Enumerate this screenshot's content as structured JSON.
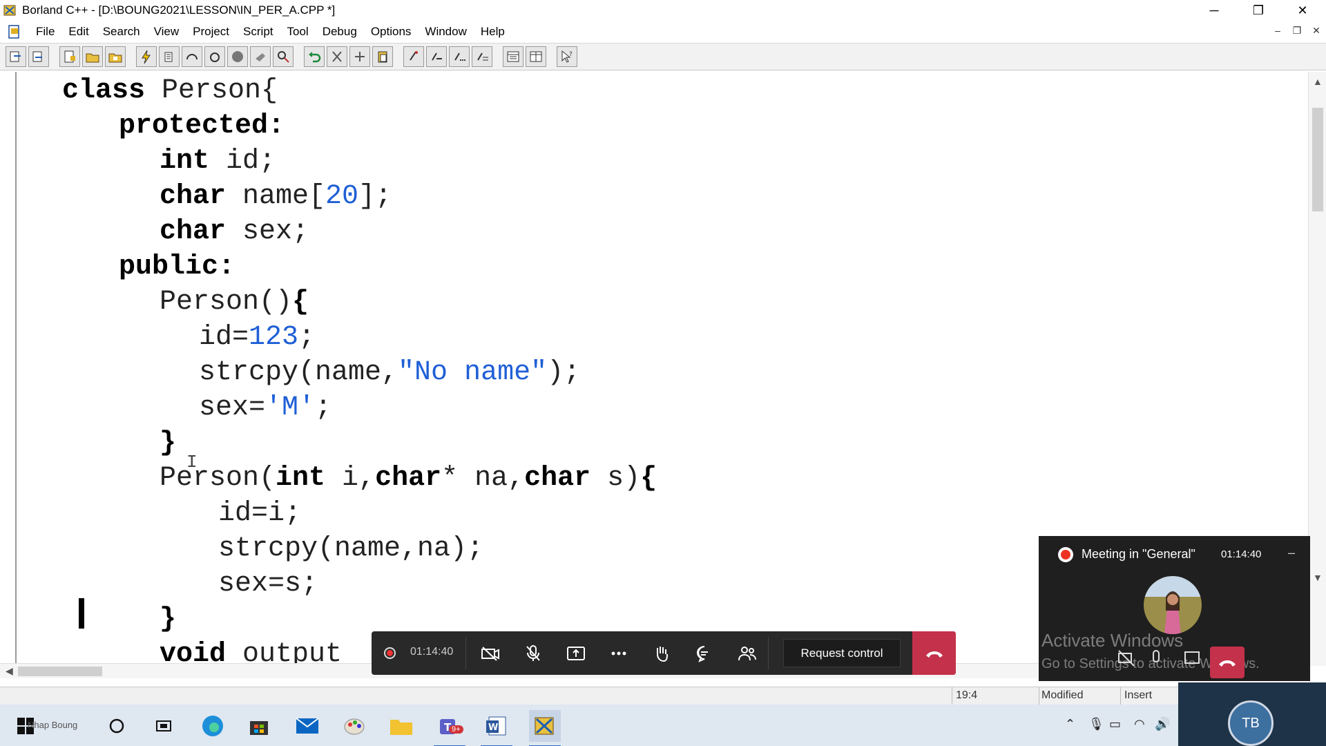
{
  "window": {
    "title": "Borland C++ - [D:\\BOUNG2021\\LESSON\\IN_PER_A.CPP *]"
  },
  "menu": [
    "File",
    "Edit",
    "Search",
    "View",
    "Project",
    "Script",
    "Tool",
    "Debug",
    "Options",
    "Window",
    "Help"
  ],
  "code": {
    "l1_kw": "class",
    "l1_rest": " Person{",
    "l2": "protected:",
    "l3_kw": "int",
    "l3_rest": " id;",
    "l4_kw": "char",
    "l4_a": " name[",
    "l4_num": "20",
    "l4_b": "];",
    "l5_kw": "char",
    "l5_rest": " sex;",
    "l6": "public:",
    "l7_a": "Person()",
    "l7_b": "{",
    "l8_a": "id=",
    "l8_num": "123",
    "l8_b": ";",
    "l9_a": "strcpy(name,",
    "l9_str": "\"No name\"",
    "l9_b": ");",
    "l10_a": "sex=",
    "l10_str": "'M'",
    "l10_b": ";",
    "l11": "}",
    "l12_a": "Person(",
    "l12_kw1": "int",
    "l12_b": " i,",
    "l12_kw2": "char",
    "l12_c": "* na,",
    "l12_kw3": "char",
    "l12_d": " s)",
    "l12_e": "{",
    "l13": "id=i;",
    "l14": "strcpy(name,na);",
    "l15": "sex=s;",
    "l16": "}",
    "l17_kw": "void",
    "l17_rest": " output"
  },
  "status": {
    "position": "19:4",
    "modified": "Modified",
    "mode": "Insert"
  },
  "callbar": {
    "timer": "01:14:40",
    "request_control": "Request control"
  },
  "meeting": {
    "title": "Meeting in \"General\"",
    "timer": "01:14:40",
    "watermark_line1": "Activate Windows",
    "watermark_line2": "Go to Settings to activate Windows."
  },
  "taskbar": {
    "search_text": "Nhap Boung",
    "user_initials": "TB",
    "teams_badge": "9+"
  }
}
